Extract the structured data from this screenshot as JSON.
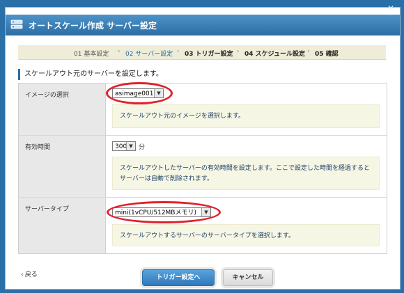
{
  "window": {
    "title": "オートスケール作成  サーバー設定",
    "close_glyph": "✕",
    "title_icon": "autoscale-app-icon"
  },
  "steps": [
    {
      "label": "01 基本設定",
      "state": "done"
    },
    {
      "label": "02 サーバー設定",
      "state": "current"
    },
    {
      "label": "03 トリガー設定",
      "state": "upcoming"
    },
    {
      "label": "04 スケジュール設定",
      "state": "upcoming"
    },
    {
      "label": "05 確認",
      "state": "upcoming"
    }
  ],
  "step_separator": "›",
  "section_heading": "スケールアウト元のサーバーを設定します。",
  "form": {
    "image": {
      "label": "イメージの選択",
      "value": "asimage001",
      "help": "スケールアウト元のイメージを選択します。",
      "highlighted": true
    },
    "ttl": {
      "label": "有効時間",
      "value": "300",
      "unit": "分",
      "help": "スケールアウトしたサーバーの有効時間を設定します。ここで設定した時間を経過するとサーバーは自動で削除されます。"
    },
    "server_type": {
      "label": "サーバータイプ",
      "value": "mini(1vCPU/512MBメモリ)",
      "help": "スケールアウトするサーバーのサーバータイプを選択します。",
      "highlighted": true
    }
  },
  "footer": {
    "back_label": "戻る",
    "next_label": "トリガー設定へ",
    "cancel_label": "キャンセル"
  },
  "colors": {
    "accent": "#2c6ea3",
    "highlight_ring": "#e0212b",
    "help_background": "#f6f6e4",
    "step_bar": "#efedd7"
  }
}
